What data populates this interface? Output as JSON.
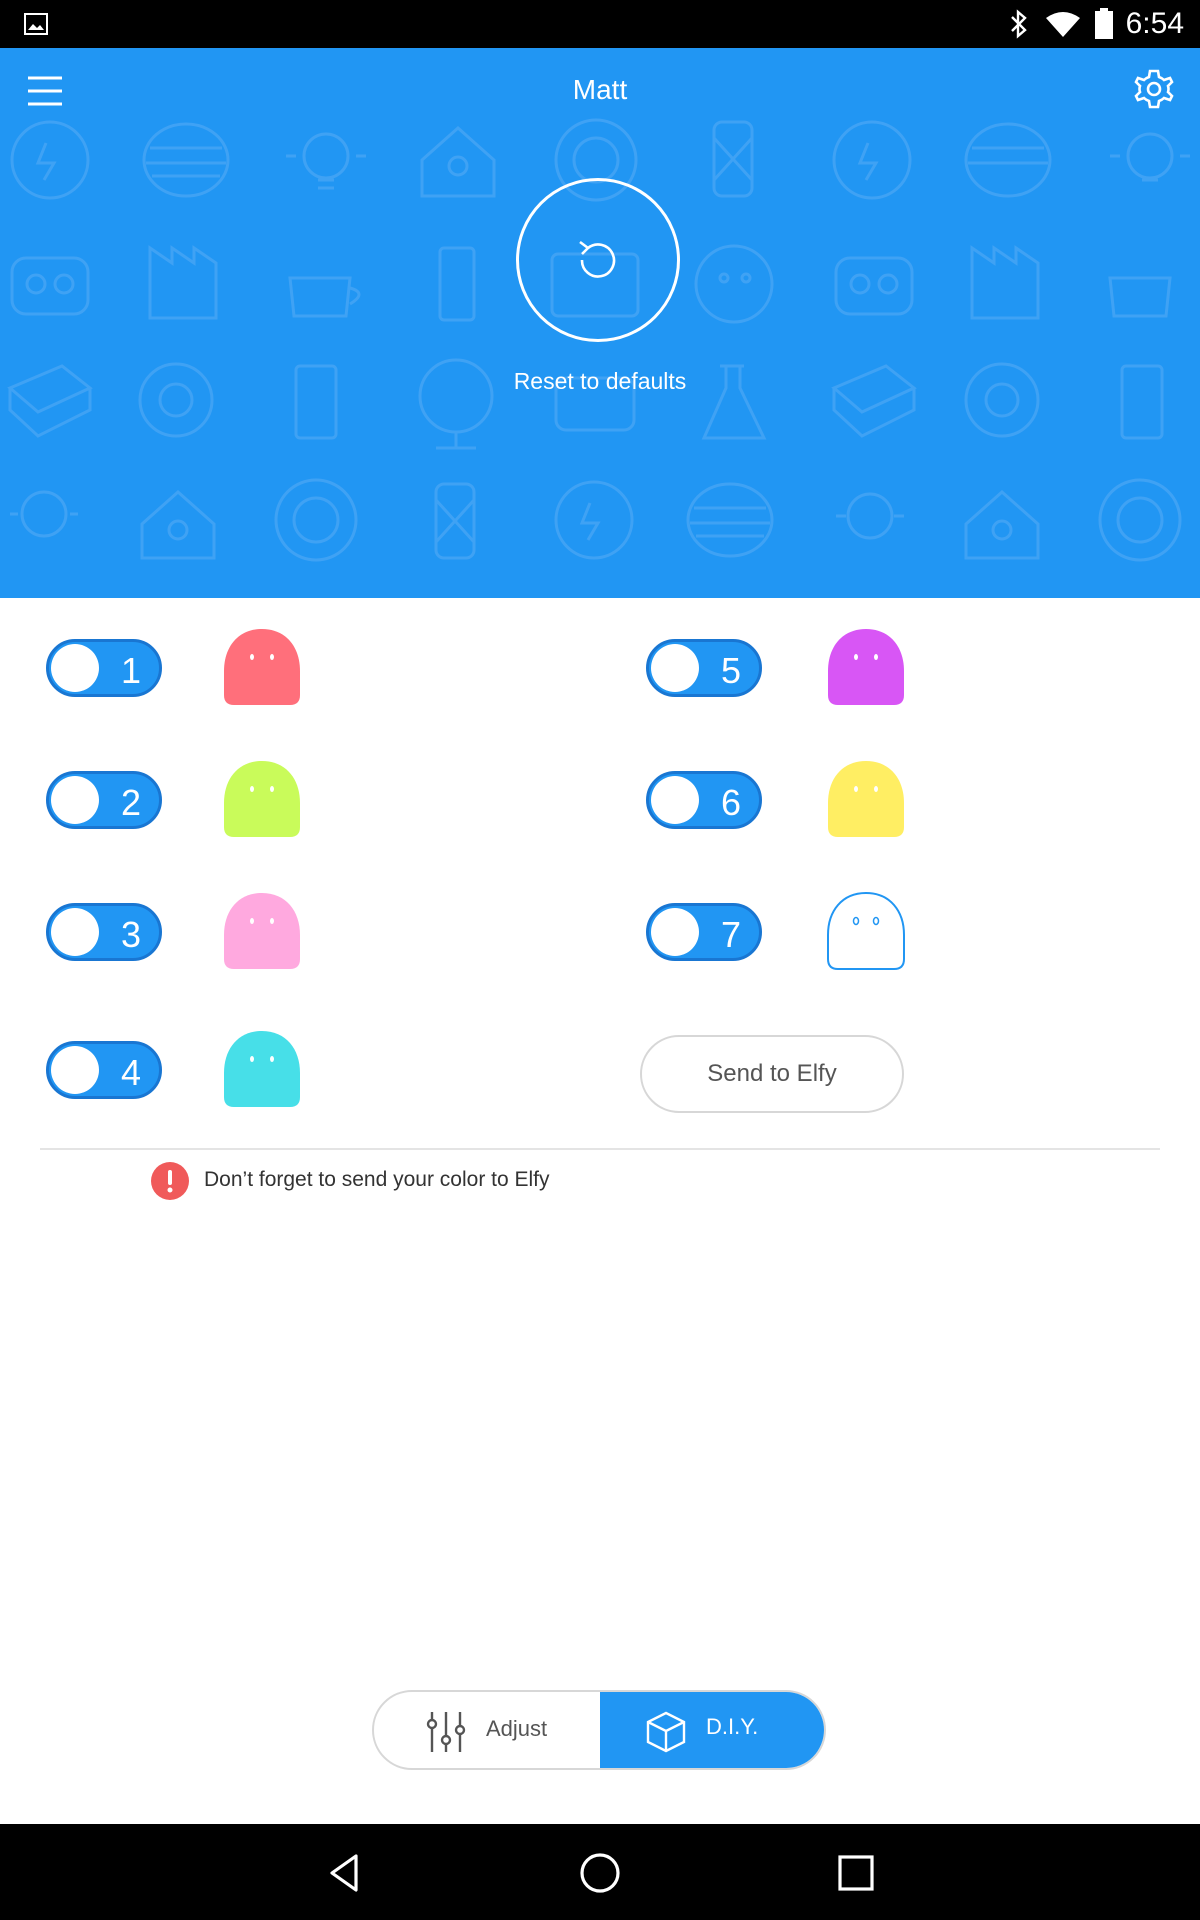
{
  "status_bar": {
    "time": "6:54"
  },
  "header": {
    "title": "Matt"
  },
  "reset": {
    "label": "Reset to defaults"
  },
  "channels": [
    {
      "number": "1",
      "color": "#ff6f7b",
      "on": true,
      "outline": false
    },
    {
      "number": "2",
      "color": "#c9fb5a",
      "on": true,
      "outline": false
    },
    {
      "number": "3",
      "color": "#ffa9df",
      "on": true,
      "outline": false
    },
    {
      "number": "4",
      "color": "#47dfe8",
      "on": true,
      "outline": false
    },
    {
      "number": "5",
      "color": "#d856f5",
      "on": true,
      "outline": false
    },
    {
      "number": "6",
      "color": "#ffee63",
      "on": true,
      "outline": false
    },
    {
      "number": "7",
      "color": "#ffffff",
      "on": true,
      "outline": true
    }
  ],
  "send_button": {
    "label": "Send to Elfy"
  },
  "notice": {
    "text": "Don’t forget to send your color to Elfy"
  },
  "mode_switch": {
    "adjust_label": "Adjust",
    "diy_label": "D.I.Y.",
    "selected": "D.I.Y."
  },
  "colors": {
    "accent": "#2196f3",
    "warning": "#f05a5a"
  }
}
